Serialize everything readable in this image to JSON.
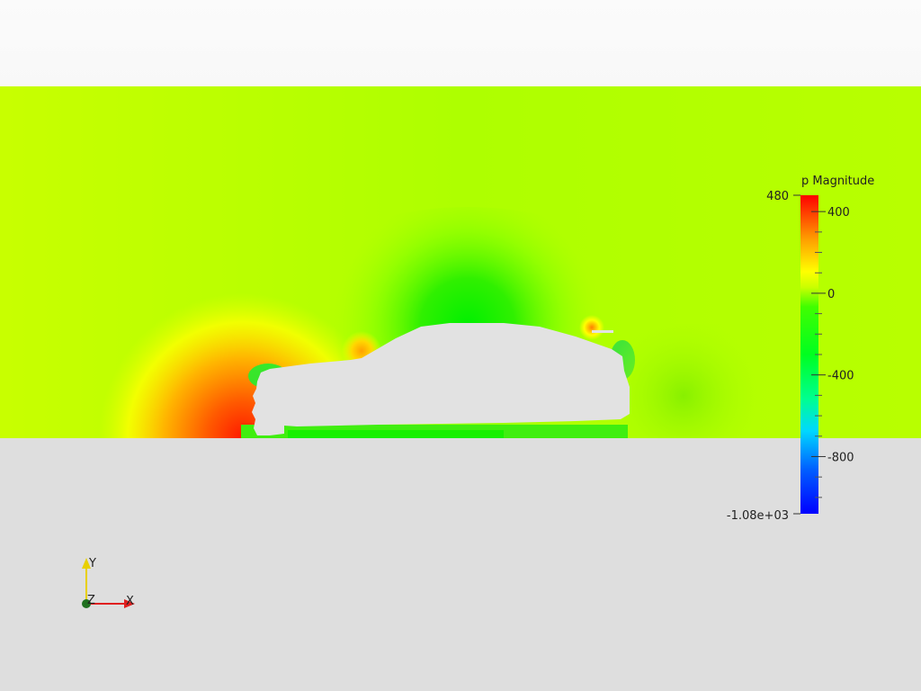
{
  "colorbar": {
    "title": "p Magnitude",
    "max_label": "480",
    "min_label": "-1.08e+03",
    "max": 480,
    "min": -1080,
    "ticks": [
      {
        "value": 400,
        "label": "400"
      },
      {
        "value": 0,
        "label": "0"
      },
      {
        "value": -400,
        "label": "-400"
      },
      {
        "value": -800,
        "label": "-800"
      }
    ],
    "colormap": [
      "#0000ff",
      "#0090ff",
      "#00ffff",
      "#00ff66",
      "#00ff00",
      "#b4ff00",
      "#ffff00",
      "#ff9900",
      "#ff0000"
    ]
  },
  "orientation_axes": {
    "x_label": "X",
    "y_label": "Y",
    "z_label": "Z",
    "x_color": "#e02020",
    "y_color": "#e8d000",
    "z_color": "#207020"
  },
  "scene": {
    "background_color": "#f4f4f4",
    "field_color": "#b4ff00",
    "ground_color": "#dedede",
    "body_color": "#e1e1e1"
  }
}
